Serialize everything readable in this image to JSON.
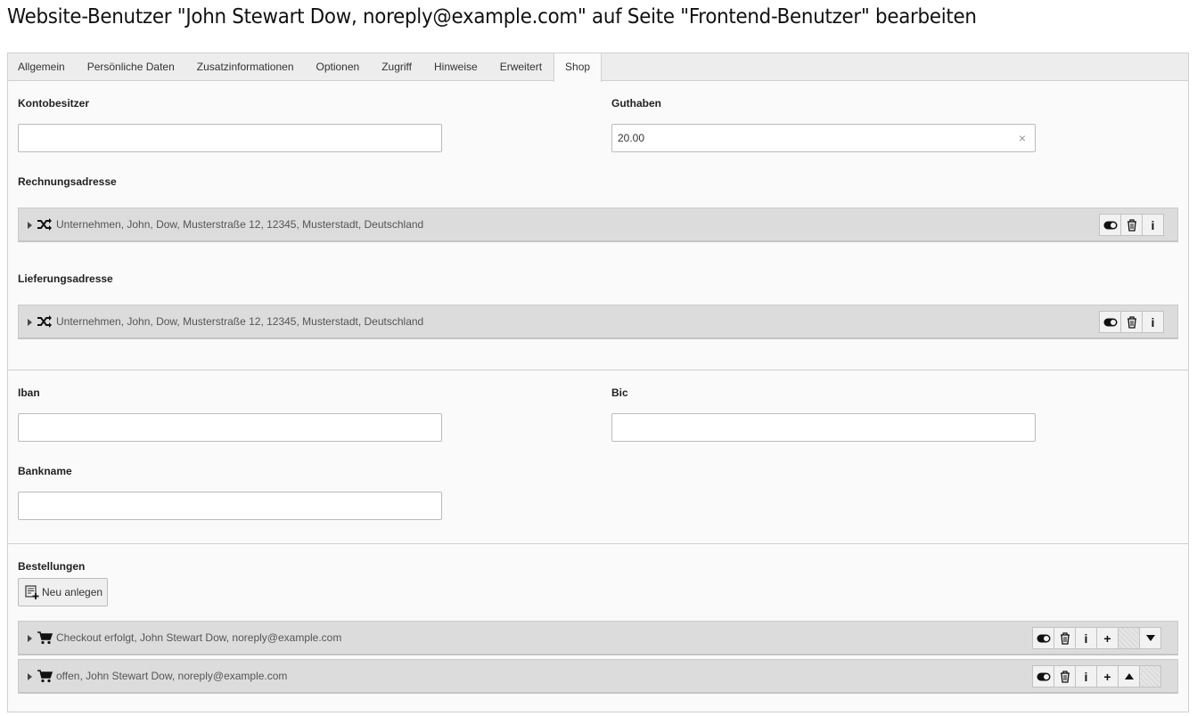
{
  "page": {
    "title": "Website-Benutzer \"John Stewart Dow, noreply@example.com\" auf Seite \"Frontend-Benutzer\" bearbeiten"
  },
  "tabs": [
    {
      "label": "Allgemein",
      "active": false
    },
    {
      "label": "Persönliche Daten",
      "active": false
    },
    {
      "label": "Zusatzinformationen",
      "active": false
    },
    {
      "label": "Optionen",
      "active": false
    },
    {
      "label": "Zugriff",
      "active": false
    },
    {
      "label": "Hinweise",
      "active": false
    },
    {
      "label": "Erweitert",
      "active": false
    },
    {
      "label": "Shop",
      "active": true
    }
  ],
  "fields": {
    "kontobesitzer": {
      "label": "Kontobesitzer",
      "value": ""
    },
    "guthaben": {
      "label": "Guthaben",
      "value": "20.00"
    },
    "rechnungsadresse": {
      "label": "Rechnungsadresse",
      "record": "Unternehmen, John, Dow, Musterstraße 12, 12345, Musterstadt, Deutschland"
    },
    "lieferungsadresse": {
      "label": "Lieferungsadresse",
      "record": "Unternehmen, John, Dow, Musterstraße 12, 12345, Musterstadt, Deutschland"
    },
    "iban": {
      "label": "Iban",
      "value": ""
    },
    "bic": {
      "label": "Bic",
      "value": ""
    },
    "bankname": {
      "label": "Bankname",
      "value": ""
    }
  },
  "orders": {
    "label": "Bestellungen",
    "new_button": "Neu anlegen",
    "items": [
      {
        "text": "Checkout erfolgt, John Stewart Dow, noreply@example.com"
      },
      {
        "text": "offen, John Stewart Dow, noreply@example.com"
      }
    ]
  },
  "icons": {
    "clear": "×",
    "info": "i",
    "add": "+",
    "address_record_icon": "shuffle-icon",
    "order_record_icon": "cart-icon"
  }
}
